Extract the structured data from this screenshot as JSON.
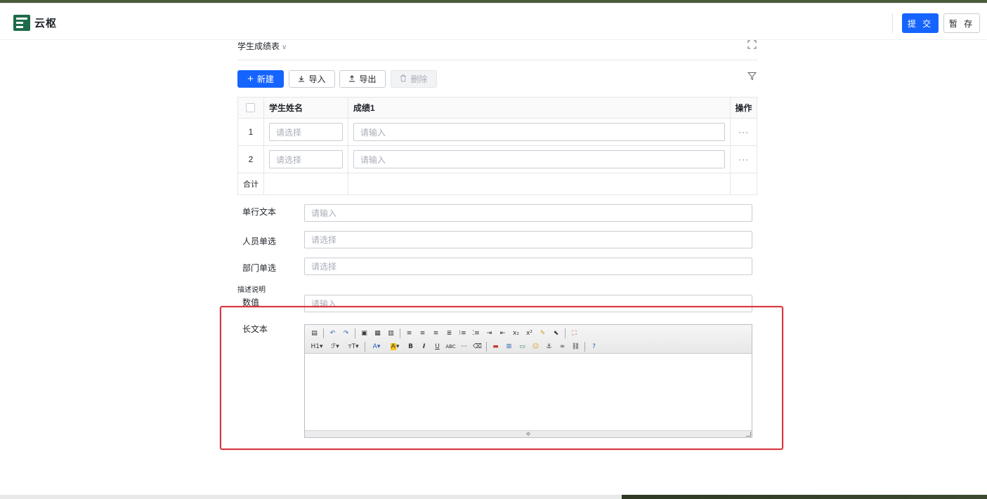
{
  "app": {
    "logo_text": "云枢"
  },
  "header": {
    "submit_label": "提 交",
    "save_label": "暂 存"
  },
  "sheet": {
    "title": "学生成绩表",
    "title_chevron": "∨"
  },
  "toolbar": {
    "new_label": "新建",
    "import_label": "导入",
    "export_label": "导出",
    "delete_label": "删除"
  },
  "table": {
    "columns": [
      "学生姓名",
      "成绩1",
      "操作"
    ],
    "rows": [
      {
        "index": "1",
        "name_placeholder": "请选择",
        "score_placeholder": "请输入",
        "ops": "···"
      },
      {
        "index": "2",
        "name_placeholder": "请选择",
        "score_placeholder": "请输入",
        "ops": "···"
      }
    ],
    "summary_label": "合计"
  },
  "fields": {
    "single_text": {
      "label": "单行文本",
      "placeholder": "请输入"
    },
    "person": {
      "label": "人员单选",
      "placeholder": "请选择"
    },
    "department": {
      "label": "部门单选",
      "placeholder": "请选择"
    },
    "description_label": "描述说明",
    "number": {
      "label": "数值",
      "placeholder": "请输入"
    },
    "long_text": {
      "label": "长文本"
    }
  },
  "editor": {
    "row1": [
      "source-icon",
      "sep",
      "undo-icon",
      "redo-icon",
      "sep",
      "insert-frame-icon",
      "paste-icon",
      "paste-text-icon",
      "sep",
      "align-left-icon",
      "align-center-icon",
      "align-right-icon",
      "justify-icon",
      "ordered-list-icon",
      "unordered-list-icon",
      "indent-icon",
      "outdent-icon",
      "subscript-icon",
      "superscript-icon",
      "format-brush-icon",
      "select-all-icon",
      "sep",
      "fullscreen-icon"
    ],
    "row2_labels": {
      "heading": "H1",
      "font_family": "ℱ",
      "font_size": "тT",
      "font_color": "A",
      "bg_color": "A",
      "bold": "B",
      "italic": "I",
      "underline": "U",
      "strike": "ABC"
    }
  },
  "colors": {
    "primary": "#1664ff",
    "highlight": "#d9363e",
    "logo": "#1e6b4a"
  }
}
